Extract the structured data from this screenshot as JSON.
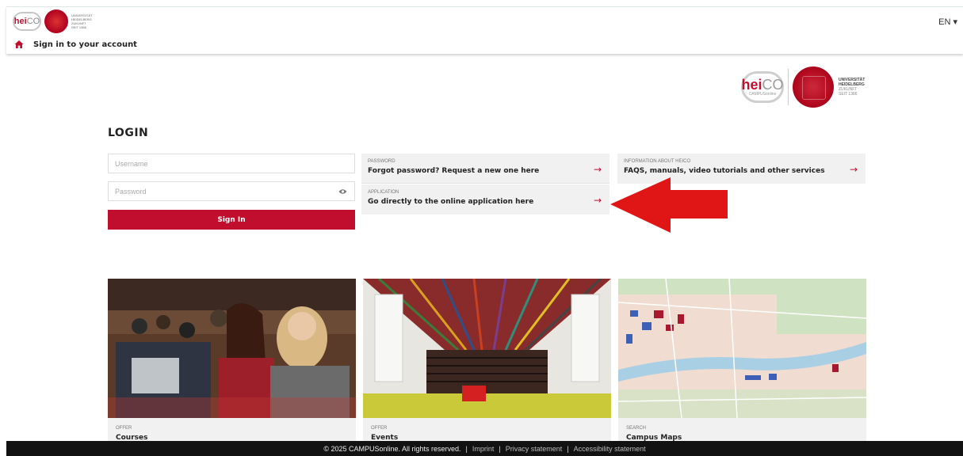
{
  "header": {
    "logo_small_text_1": "hei",
    "logo_small_text_2": "CO",
    "uni_small": "UNIVERSITÄT HEIDELBERG ZUKUNFT SEIT 1386",
    "language": "EN ▾",
    "breadcrumb": "Sign in to your account"
  },
  "logo": {
    "heico_1": "hei",
    "heico_2": "CO",
    "campus": "CAMPUSonline",
    "uni_line1": "UNIVERSITÄT",
    "uni_line2": "HEIDELBERG",
    "uni_line3": "ZUKUNFT",
    "uni_line4": "SEIT 1386"
  },
  "login": {
    "title": "LOGIN",
    "username_placeholder": "Username",
    "password_placeholder": "Password",
    "signin_label": "Sign In"
  },
  "cards": [
    {
      "category": "PASSWORD",
      "text": "Forgot password? Request a new one here",
      "arrow": "→"
    },
    {
      "category": "APPLICATION",
      "text": "Go directly to the online application here",
      "arrow": "→"
    },
    {
      "category": "INFORMATION ABOUT HEICO",
      "text": "FAQS, manuals, video tutorials and other services",
      "arrow": "→"
    }
  ],
  "tiles": [
    {
      "category": "OFFER",
      "title": "Courses"
    },
    {
      "category": "OFFER",
      "title": "Events"
    },
    {
      "category": "SEARCH",
      "title": "Campus Maps"
    }
  ],
  "footer": {
    "copyright": "© 2025 CAMPUSonline. All rights reserved.",
    "sep": "|",
    "imprint": "Imprint",
    "privacy": "Privacy statement",
    "accessibility": "Accessibility statement"
  },
  "colors": {
    "accent": "#c20e2e",
    "card_bg": "#f1f1f1",
    "footer_bg": "#121212"
  },
  "icons": {
    "home": "home-icon",
    "eye": "eye-icon",
    "arrow": "arrow-right-icon",
    "annotation": "red-arrow-annotation"
  }
}
